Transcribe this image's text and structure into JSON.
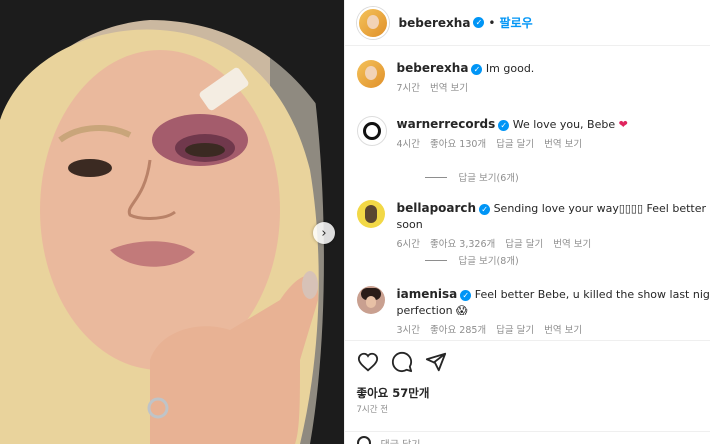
{
  "post": {
    "author": "beberexha",
    "follow_label": "팔로우",
    "caption": "Im good.",
    "caption_time": "7시간",
    "translate_label": "번역 보기"
  },
  "comments": [
    {
      "user": "warnerrecords",
      "text": "We love you, Bebe",
      "emoji": "❤",
      "time": "4시간",
      "likes": "좋아요 130개",
      "reply": "답글 달기",
      "translate": "번역 보기",
      "replies": "답글 보기(6개)"
    },
    {
      "user": "bellapoarch",
      "text": "Sending love your way▯▯▯▯ Feel better soon",
      "time": "6시간",
      "likes": "좋아요 3,326개",
      "reply": "답글 달기",
      "translate": "번역 보기",
      "replies": "답글 보기(8개)"
    },
    {
      "user": "iamenisa",
      "text": "Feel better Bebe, u killed the show last night! Po",
      "text2": "perfection 😱",
      "time": "3시간",
      "likes": "좋아요 285개",
      "reply": "답글 달기",
      "translate": "번역 보기"
    }
  ],
  "footer": {
    "like_count": "좋아요 57만개",
    "posted": "7시간 전",
    "add_comment": "댓글 달기..."
  },
  "icons": {
    "like": "heart-icon",
    "comment": "comment-icon",
    "share": "send-icon",
    "next": "chevron-right-icon",
    "verified": "verified-badge-icon"
  },
  "colors": {
    "accent": "#0095f6",
    "muted": "#8e8e8e",
    "text": "#262626",
    "heart": "#e0245e"
  }
}
